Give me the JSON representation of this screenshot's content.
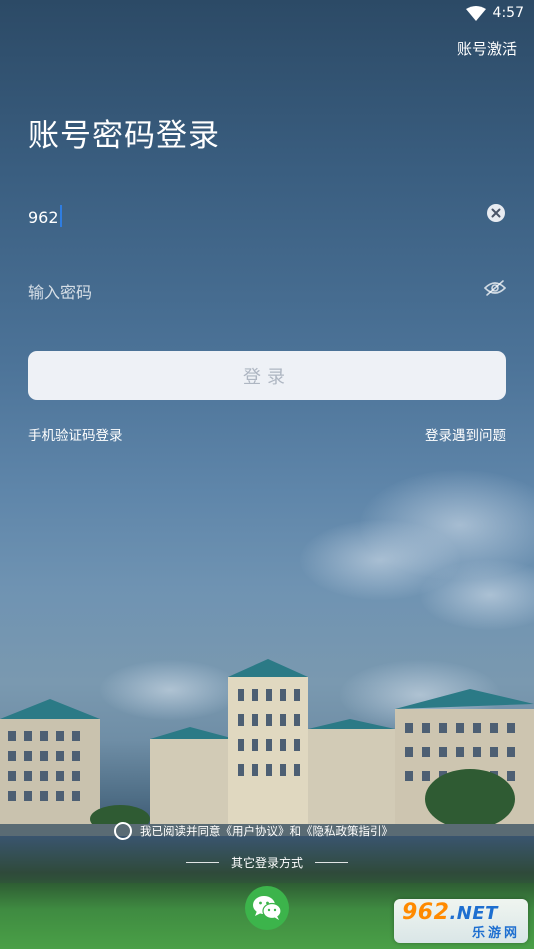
{
  "status_bar": {
    "time": "4:57"
  },
  "header": {
    "activate_label": "账号激活"
  },
  "title": "账号密码登录",
  "account_field": {
    "value": "962"
  },
  "password_field": {
    "placeholder": "输入密码"
  },
  "login_button": {
    "label": "登录"
  },
  "links": {
    "sms_login": "手机验证码登录",
    "trouble": "登录遇到问题"
  },
  "agreement": {
    "prefix": "我已阅读并同意",
    "user_agreement": "《用户协议》",
    "conjunction": "和",
    "privacy_policy": "《隐私政策指引》"
  },
  "other_login": {
    "label": "其它登录方式"
  },
  "watermark": {
    "brand_number": "962",
    "brand_suffix": ".NET",
    "brand_cn": "乐游网"
  },
  "colors": {
    "accent_caret": "#2f7de1",
    "login_button_bg": "#eef1f6",
    "login_button_text": "#aeb6c2",
    "wechat_green": "#3cb44b"
  },
  "icons": {
    "wifi": "wifi-icon",
    "clear": "clear-icon",
    "password_visibility": "eye-off-icon",
    "agree": "radio-unchecked-icon",
    "wechat": "wechat-icon"
  }
}
